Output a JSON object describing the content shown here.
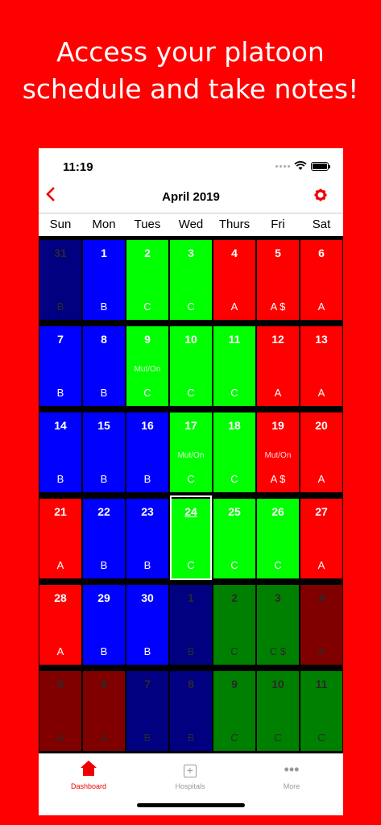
{
  "promo": {
    "line1": "Access your platoon",
    "line2": "schedule and take notes!"
  },
  "status": {
    "time": "11:19"
  },
  "nav": {
    "back_icon": "chevron-left-icon",
    "title": "April 2019",
    "settings_icon": "gear-icon"
  },
  "weekdays": [
    "Sun",
    "Mon",
    "Tues",
    "Wed",
    "Thurs",
    "Fri",
    "Sat"
  ],
  "colors": {
    "A": "#ff0000",
    "B": "#0000ff",
    "C": "#00ff00",
    "A_dim": "#800000",
    "B_dim": "#000080",
    "C_dim": "#008000",
    "accent": "#e00000"
  },
  "calendar": [
    {
      "day": "31",
      "platoon": "B",
      "note": "",
      "dim": true
    },
    {
      "day": "1",
      "platoon": "B",
      "note": "",
      "dim": false
    },
    {
      "day": "2",
      "platoon": "C",
      "note": "",
      "dim": false
    },
    {
      "day": "3",
      "platoon": "C",
      "note": "",
      "dim": false
    },
    {
      "day": "4",
      "platoon": "A",
      "note": "",
      "dim": false
    },
    {
      "day": "5",
      "platoon": "A $",
      "note": "",
      "dim": false
    },
    {
      "day": "6",
      "platoon": "A",
      "note": "",
      "dim": false
    },
    {
      "day": "7",
      "platoon": "B",
      "note": "",
      "dim": false
    },
    {
      "day": "8",
      "platoon": "B",
      "note": "",
      "dim": false
    },
    {
      "day": "9",
      "platoon": "C",
      "note": "Mut/On",
      "dim": false
    },
    {
      "day": "10",
      "platoon": "C",
      "note": "",
      "dim": false
    },
    {
      "day": "11",
      "platoon": "C",
      "note": "",
      "dim": false
    },
    {
      "day": "12",
      "platoon": "A",
      "note": "",
      "dim": false
    },
    {
      "day": "13",
      "platoon": "A",
      "note": "",
      "dim": false
    },
    {
      "day": "14",
      "platoon": "B",
      "note": "",
      "dim": false
    },
    {
      "day": "15",
      "platoon": "B",
      "note": "",
      "dim": false
    },
    {
      "day": "16",
      "platoon": "B",
      "note": "",
      "dim": false
    },
    {
      "day": "17",
      "platoon": "C",
      "note": "Mut/On",
      "dim": false
    },
    {
      "day": "18",
      "platoon": "C",
      "note": "",
      "dim": false
    },
    {
      "day": "19",
      "platoon": "A $",
      "note": "Mut/On",
      "dim": false
    },
    {
      "day": "20",
      "platoon": "A",
      "note": "",
      "dim": false
    },
    {
      "day": "21",
      "platoon": "A",
      "note": "",
      "dim": false
    },
    {
      "day": "22",
      "platoon": "B",
      "note": "",
      "dim": false
    },
    {
      "day": "23",
      "platoon": "B",
      "note": "",
      "dim": false
    },
    {
      "day": "24",
      "platoon": "C",
      "note": "",
      "dim": false,
      "today": true
    },
    {
      "day": "25",
      "platoon": "C",
      "note": "",
      "dim": false
    },
    {
      "day": "26",
      "platoon": "C",
      "note": "",
      "dim": false
    },
    {
      "day": "27",
      "platoon": "A",
      "note": "",
      "dim": false
    },
    {
      "day": "28",
      "platoon": "A",
      "note": "",
      "dim": false
    },
    {
      "day": "29",
      "platoon": "B",
      "note": "",
      "dim": false
    },
    {
      "day": "30",
      "platoon": "B",
      "note": "",
      "dim": false
    },
    {
      "day": "1",
      "platoon": "B",
      "note": "",
      "dim": true
    },
    {
      "day": "2",
      "platoon": "C",
      "note": "",
      "dim": true
    },
    {
      "day": "3",
      "platoon": "C $",
      "note": "",
      "dim": true
    },
    {
      "day": "4",
      "platoon": "A",
      "note": "",
      "dim": true
    },
    {
      "day": "5",
      "platoon": "A",
      "note": "",
      "dim": true
    },
    {
      "day": "6",
      "platoon": "A",
      "note": "",
      "dim": true
    },
    {
      "day": "7",
      "platoon": "B",
      "note": "",
      "dim": true
    },
    {
      "day": "8",
      "platoon": "B",
      "note": "",
      "dim": true
    },
    {
      "day": "9",
      "platoon": "C",
      "note": "",
      "dim": true
    },
    {
      "day": "10",
      "platoon": "C",
      "note": "",
      "dim": true
    },
    {
      "day": "11",
      "platoon": "C",
      "note": "",
      "dim": true
    }
  ],
  "tabs": [
    {
      "label": "Dashboard",
      "icon": "house-icon",
      "active": true
    },
    {
      "label": "Hospitals",
      "icon": "plus-square-icon",
      "active": false
    },
    {
      "label": "More",
      "icon": "more-dots-icon",
      "active": false
    }
  ]
}
